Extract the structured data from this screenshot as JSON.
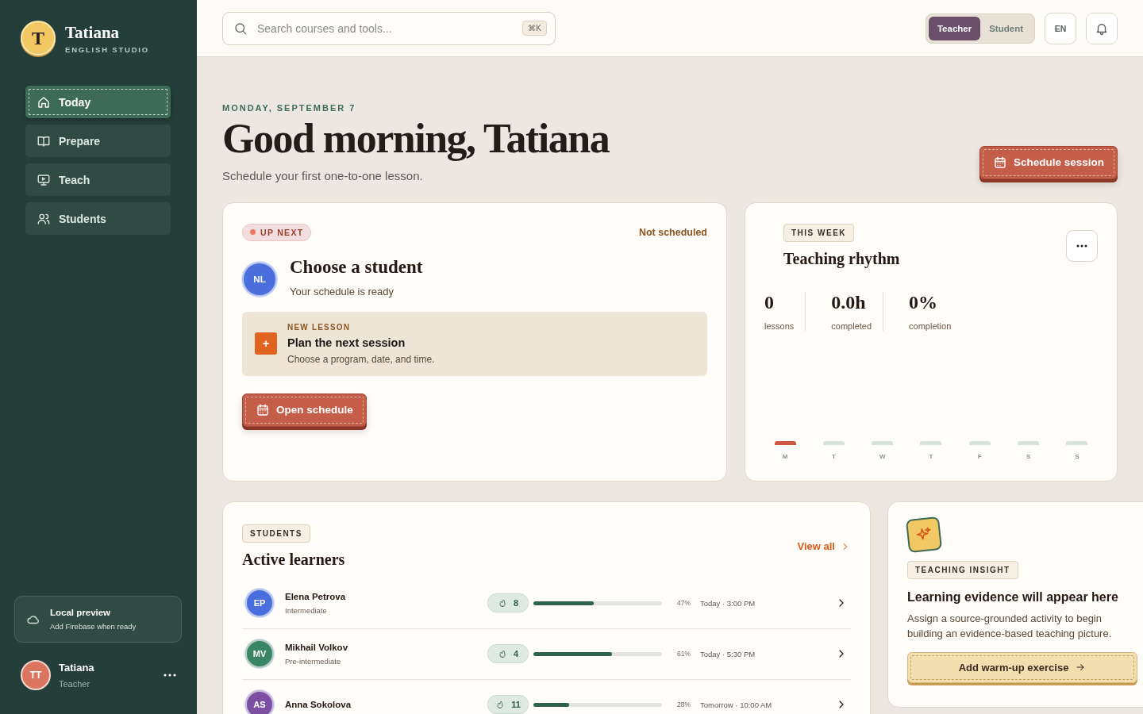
{
  "brand": {
    "initial": "T",
    "name": "Tatiana",
    "subtitle": "ENGLISH STUDIO"
  },
  "nav": [
    {
      "label": "Today",
      "selected": true
    },
    {
      "label": "Prepare",
      "selected": false
    },
    {
      "label": "Teach",
      "selected": false
    },
    {
      "label": "Students",
      "selected": false
    }
  ],
  "connection": {
    "title": "Local preview",
    "subtitle": "Add Firebase when ready"
  },
  "user": {
    "initials": "TT",
    "name": "Tatiana",
    "role": "Teacher"
  },
  "search": {
    "placeholder": "Search courses and tools...",
    "shortcut": "⌘K"
  },
  "role_toggle": [
    {
      "label": "Teacher",
      "selected": true
    },
    {
      "label": "Student",
      "selected": false
    }
  ],
  "language": "EN",
  "hero": {
    "date": "MONDAY, SEPTEMBER 7",
    "title": "Good morning, Tatiana",
    "subtitle": "Schedule your first one-to-one lesson.",
    "action": "Schedule session"
  },
  "up_next": {
    "badge": "UP NEXT",
    "status": "Not scheduled",
    "avatar": "NL",
    "title": "Choose a student",
    "subtitle": "Your schedule is ready",
    "callout": {
      "eyebrow": "NEW LESSON",
      "icon": "+",
      "title": "Plan the next session",
      "text": "Choose a program, date, and time."
    },
    "action": "Open schedule"
  },
  "week": {
    "badge": "THIS WEEK",
    "title": "Teaching rhythm",
    "stats": [
      {
        "value": "0",
        "label": "lessons"
      },
      {
        "value": "0.0h",
        "label": "completed"
      },
      {
        "value": "0%",
        "label": "completion"
      }
    ],
    "days": [
      {
        "label": "M",
        "selected": true
      },
      {
        "label": "T",
        "selected": false
      },
      {
        "label": "W",
        "selected": false
      },
      {
        "label": "T",
        "selected": false
      },
      {
        "label": "F",
        "selected": false
      },
      {
        "label": "S",
        "selected": false
      },
      {
        "label": "S",
        "selected": false
      }
    ]
  },
  "students": {
    "badge": "STUDENTS",
    "title": "Active learners",
    "link": "View all",
    "rows": [
      {
        "initials": "EP",
        "color": "#4a6fdc",
        "name": "Elena Petrova",
        "level_name": "Intermediate",
        "streak": "8",
        "level": 0.47,
        "percent": "47%",
        "next": "Today · 3:00 PM"
      },
      {
        "initials": "MV",
        "color": "#3a8566",
        "name": "Mikhail Volkov",
        "level_name": "Pre-intermediate",
        "streak": "4",
        "level": 0.61,
        "percent": "61%",
        "next": "Today · 5:30 PM"
      },
      {
        "initials": "AS",
        "color": "#7d4fa3",
        "name": "Anna Sokolova",
        "streak": "11",
        "level": 0.28,
        "percent": "28%",
        "next": "Tomorrow · 10:00 AM"
      }
    ]
  },
  "insight": {
    "badge": "TEACHING INSIGHT",
    "title": "Learning evidence will appear here",
    "text": "Assign a source-grounded activity to begin building an evidence-based teaching picture.",
    "action": "Add warm-up exercise"
  }
}
